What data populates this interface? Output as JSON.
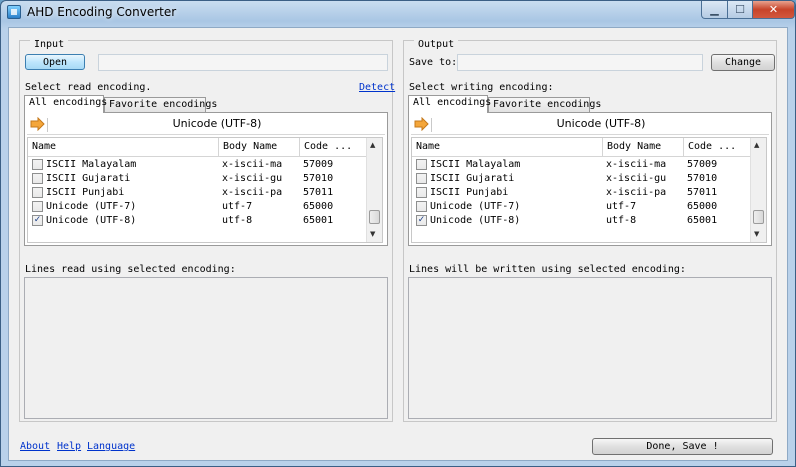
{
  "window": {
    "title": "AHD Encoding Converter",
    "minimize": "▁",
    "maximize": "☐",
    "close": "✕"
  },
  "input": {
    "legend": "Input",
    "open_label": "Open",
    "select_label": "Select read encoding.",
    "detect_label": "Detect",
    "tabs": [
      "All encodings",
      "Favorite encodings"
    ],
    "current_encoding": "Unicode (UTF-8)",
    "columns": [
      "Name",
      "Body Name",
      "Code ..."
    ],
    "rows": [
      {
        "name": "ISCII Malayalam",
        "body": "x-iscii-ma",
        "code": "57009",
        "checked": false
      },
      {
        "name": "ISCII Gujarati",
        "body": "x-iscii-gu",
        "code": "57010",
        "checked": false
      },
      {
        "name": "ISCII Punjabi",
        "body": "x-iscii-pa",
        "code": "57011",
        "checked": false
      },
      {
        "name": "Unicode (UTF-7)",
        "body": "utf-7",
        "code": "65000",
        "checked": false
      },
      {
        "name": "Unicode (UTF-8)",
        "body": "utf-8",
        "code": "65001",
        "checked": true
      }
    ],
    "lines_label": "Lines read using selected encoding:"
  },
  "output": {
    "legend": "Output",
    "save_to_label": "Save to:",
    "change_label": "Change",
    "select_label": "Select writing encoding:",
    "tabs": [
      "All encodings",
      "Favorite encodings"
    ],
    "current_encoding": "Unicode (UTF-8)",
    "columns": [
      "Name",
      "Body Name",
      "Code ..."
    ],
    "rows": [
      {
        "name": "ISCII Malayalam",
        "body": "x-iscii-ma",
        "code": "57009",
        "checked": false
      },
      {
        "name": "ISCII Gujarati",
        "body": "x-iscii-gu",
        "code": "57010",
        "checked": false
      },
      {
        "name": "ISCII Punjabi",
        "body": "x-iscii-pa",
        "code": "57011",
        "checked": false
      },
      {
        "name": "Unicode (UTF-7)",
        "body": "utf-7",
        "code": "65000",
        "checked": false
      },
      {
        "name": "Unicode (UTF-8)",
        "body": "utf-8",
        "code": "65001",
        "checked": true
      }
    ],
    "lines_label": "Lines will be written using selected encoding:"
  },
  "footer": {
    "about": "About",
    "help": "Help",
    "language": "Language",
    "done_label": "Done, Save !"
  },
  "check_mark": "✓"
}
